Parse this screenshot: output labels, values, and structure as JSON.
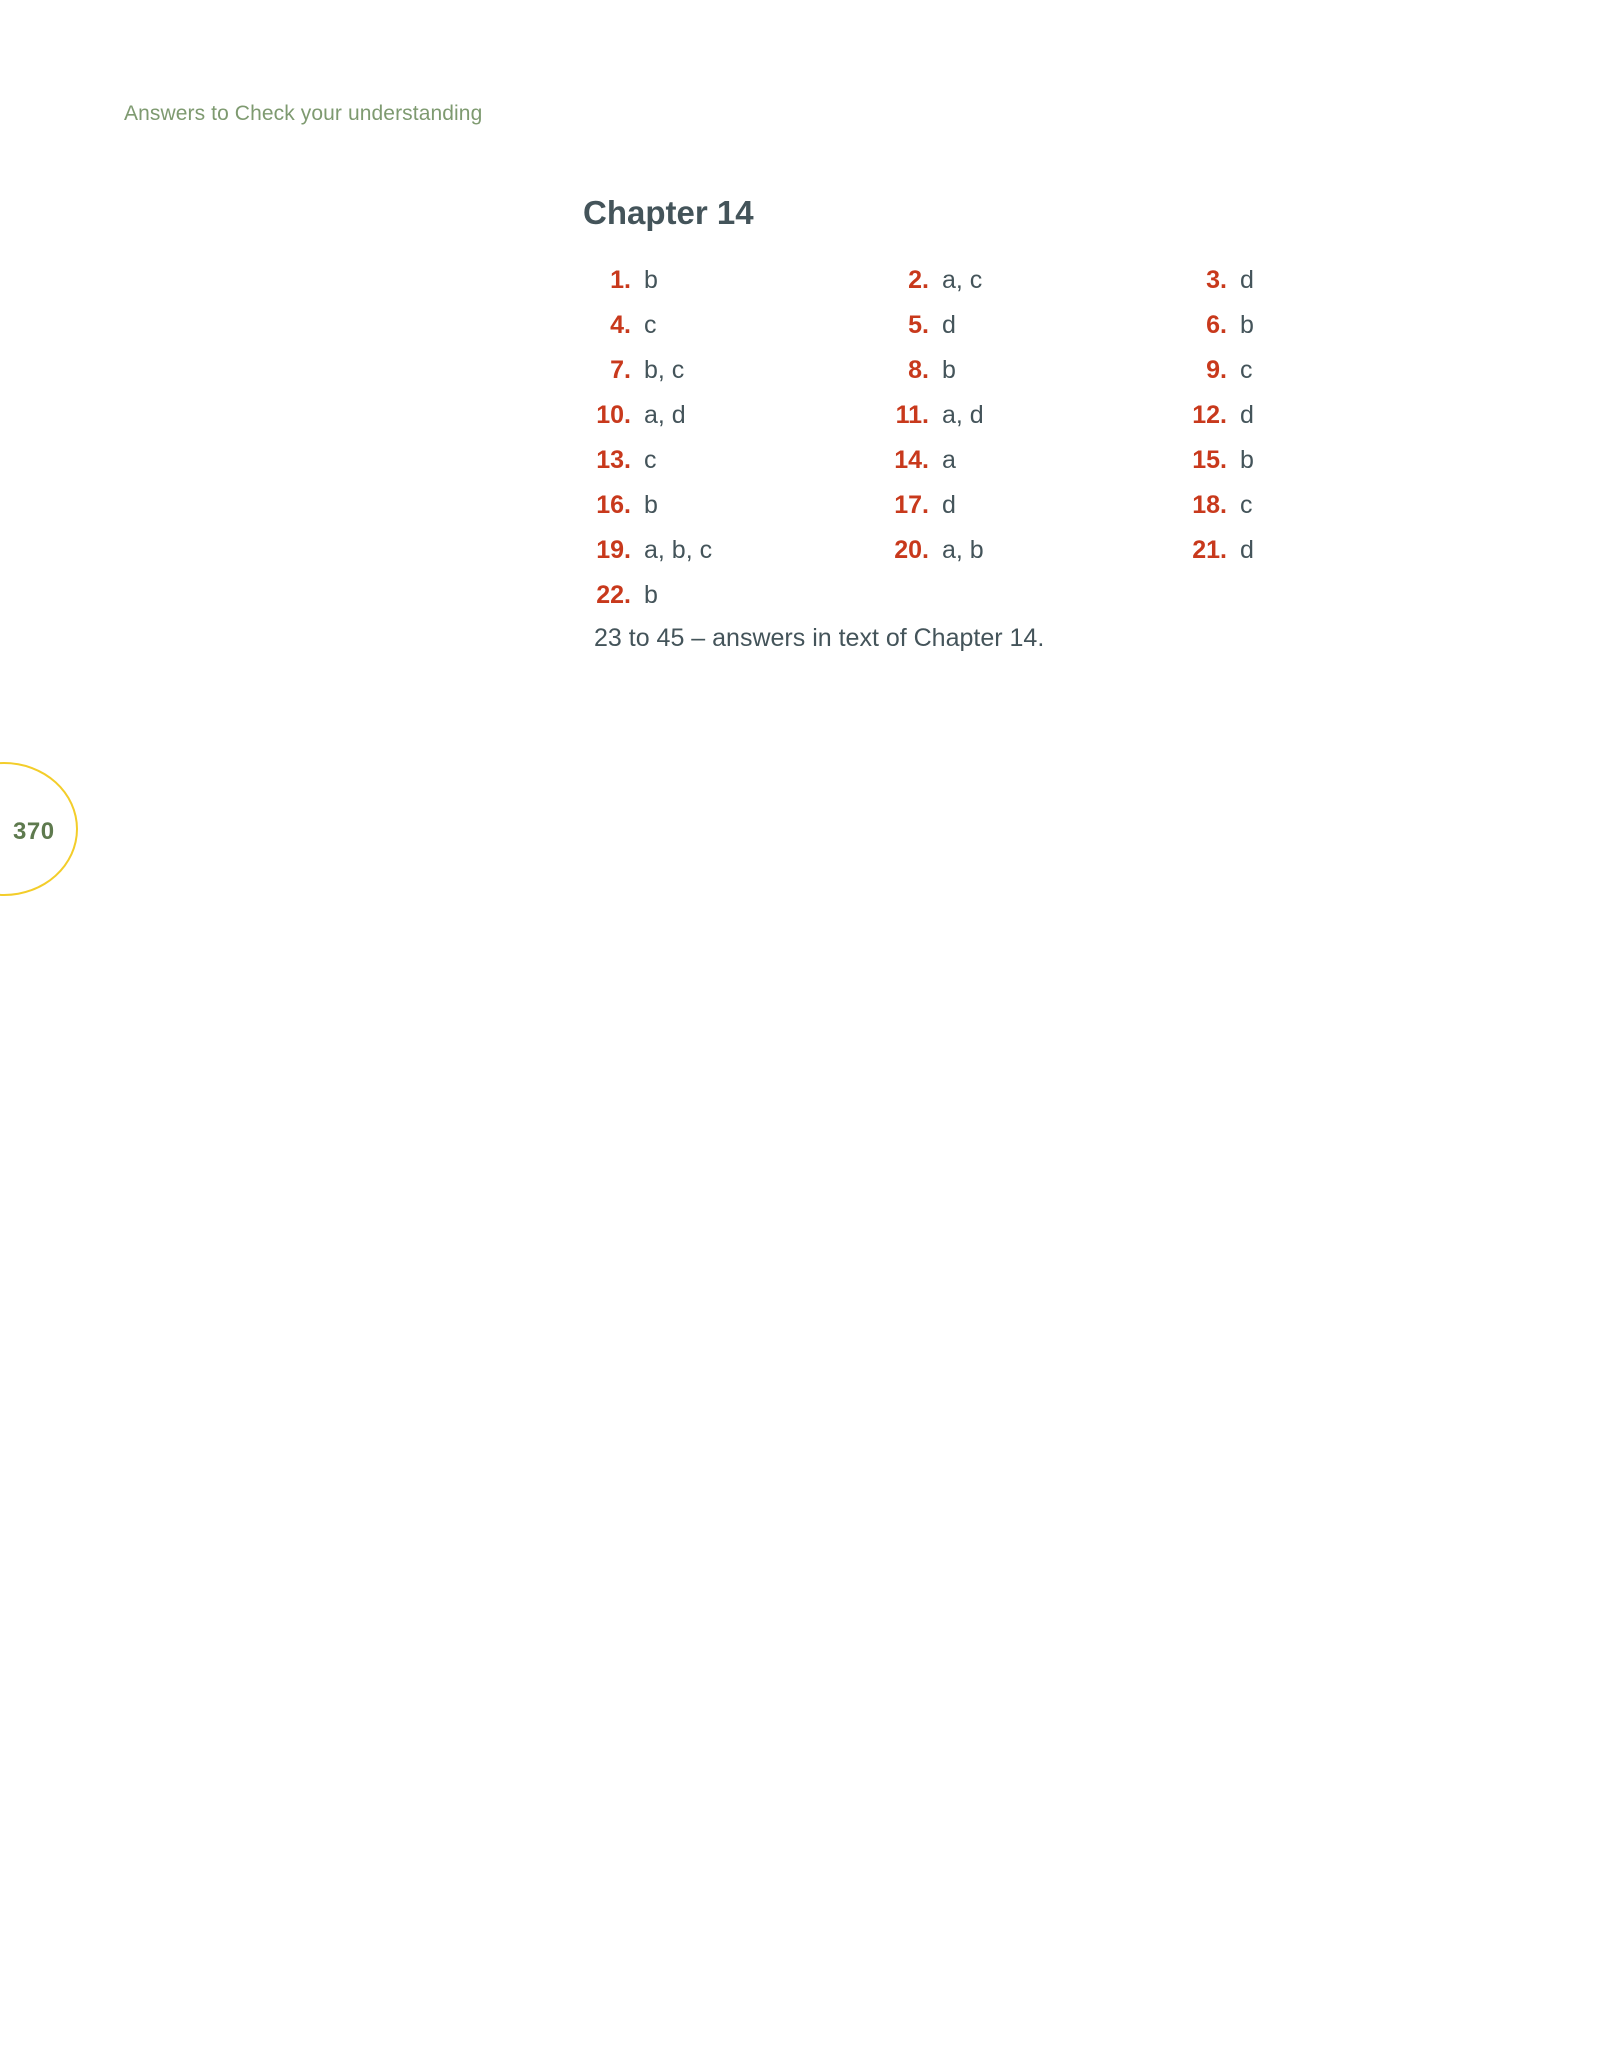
{
  "running_head": "Answers to Check your understanding",
  "chapter": {
    "title": "Chapter 14"
  },
  "answers": [
    {
      "num": "1.",
      "val": "b"
    },
    {
      "num": "2.",
      "val": "a, c"
    },
    {
      "num": "3.",
      "val": "d"
    },
    {
      "num": "4.",
      "val": "c"
    },
    {
      "num": "5.",
      "val": "d"
    },
    {
      "num": "6.",
      "val": "b"
    },
    {
      "num": "7.",
      "val": "b, c"
    },
    {
      "num": "8.",
      "val": "b"
    },
    {
      "num": "9.",
      "val": "c"
    },
    {
      "num": "10.",
      "val": "a, d"
    },
    {
      "num": "11.",
      "val": "a, d"
    },
    {
      "num": "12.",
      "val": "d"
    },
    {
      "num": "13.",
      "val": "c"
    },
    {
      "num": "14.",
      "val": "a"
    },
    {
      "num": "15.",
      "val": "b"
    },
    {
      "num": "16.",
      "val": "b"
    },
    {
      "num": "17.",
      "val": "d"
    },
    {
      "num": "18.",
      "val": "c"
    },
    {
      "num": "19.",
      "val": "a, b, c"
    },
    {
      "num": "20.",
      "val": "a, b"
    },
    {
      "num": "21.",
      "val": "d"
    },
    {
      "num": "22.",
      "val": "b"
    }
  ],
  "note": "23 to 45 – answers in text of Chapter 14.",
  "page_number": "370",
  "colors": {
    "running_head": "#7e9a70",
    "answer_number": "#c8391c",
    "body_text": "#44545a",
    "page_circle": "#f3cd2a",
    "page_number": "#5e7a4e"
  }
}
